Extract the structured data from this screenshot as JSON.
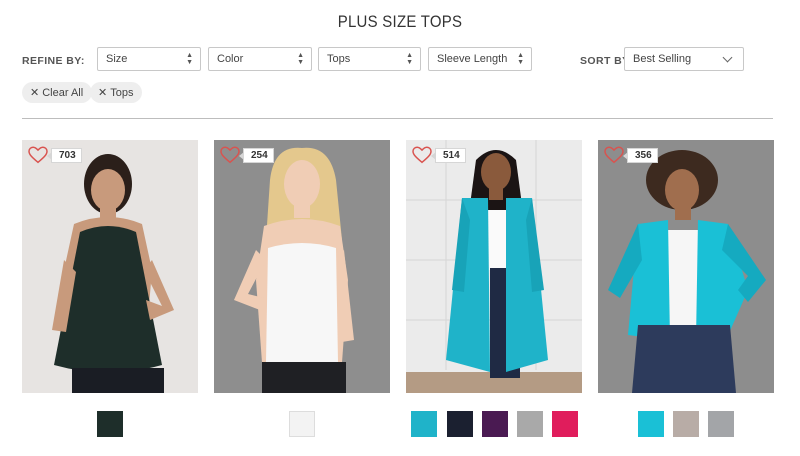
{
  "page": {
    "title": "PLUS SIZE TOPS"
  },
  "filters": {
    "refine_label": "REFINE BY:",
    "selects": [
      "Size",
      "Color",
      "Tops",
      "Sleeve Length"
    ],
    "sort_label": "SORT BY:",
    "sort_value": "Best Selling"
  },
  "chips": [
    {
      "label": "Clear All"
    },
    {
      "label": "Tops"
    }
  ],
  "products": [
    {
      "likes": "703",
      "swatches": [
        "#1e2e2a"
      ]
    },
    {
      "likes": "254",
      "swatches": [
        "#f3f3f3"
      ]
    },
    {
      "likes": "514",
      "swatches": [
        "#1fb3c9",
        "#1b2030",
        "#4a1a52",
        "#a9a9a9",
        "#e01d5c"
      ]
    },
    {
      "likes": "356",
      "swatches": [
        "#1ac0d6",
        "#b8aca6",
        "#a3a5a8"
      ]
    }
  ],
  "colors": {
    "heart": "#d9534f",
    "divider": "#bdbdbd"
  }
}
